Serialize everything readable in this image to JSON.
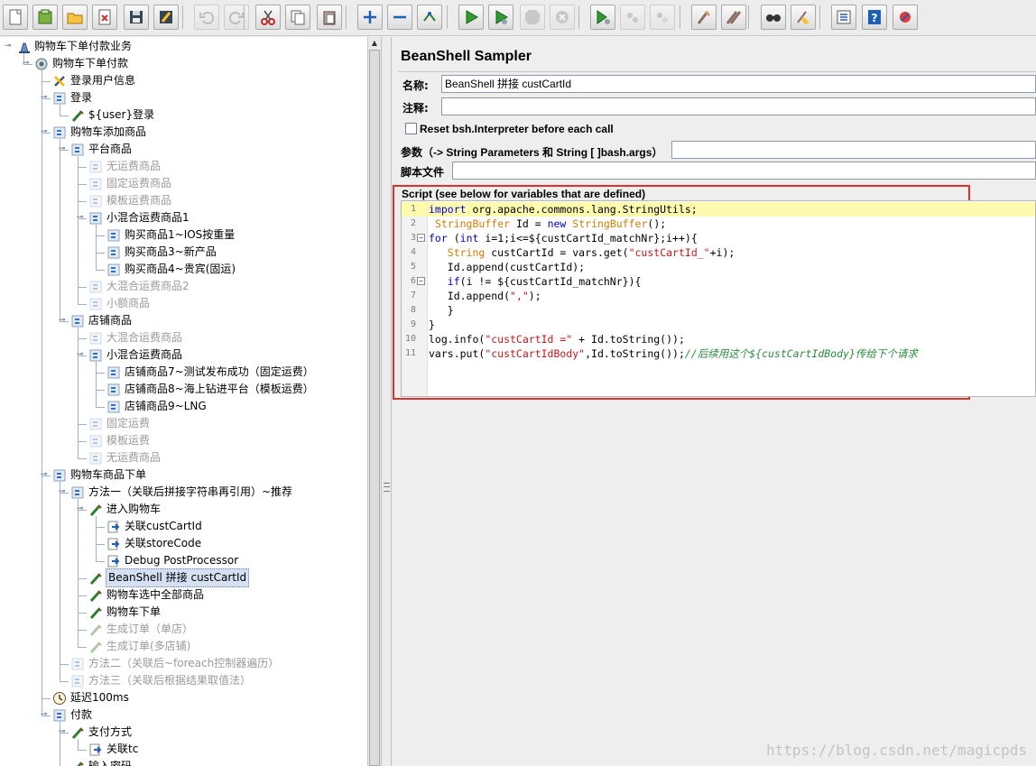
{
  "toolbar": {
    "buttons": [
      {
        "name": "new-icon",
        "disabled": false
      },
      {
        "name": "templates-icon",
        "disabled": false
      },
      {
        "name": "open-icon",
        "disabled": false
      },
      {
        "name": "close-icon",
        "disabled": false
      },
      {
        "name": "save-icon",
        "disabled": false
      },
      {
        "name": "save-screenshot-icon",
        "disabled": false
      },
      {
        "name": "undo-icon",
        "disabled": true
      },
      {
        "name": "redo-icon",
        "disabled": true
      },
      {
        "name": "cut-icon",
        "disabled": false
      },
      {
        "name": "copy-icon",
        "disabled": false
      },
      {
        "name": "paste-icon",
        "disabled": false
      },
      {
        "name": "expand-icon",
        "disabled": false
      },
      {
        "name": "collapse-icon",
        "disabled": false
      },
      {
        "name": "toggle-icon",
        "disabled": false
      },
      {
        "name": "start-icon",
        "disabled": false
      },
      {
        "name": "start-no-pauses-icon",
        "disabled": false
      },
      {
        "name": "stop-icon",
        "disabled": true
      },
      {
        "name": "shutdown-icon",
        "disabled": true
      },
      {
        "name": "remote-start-icon",
        "disabled": false
      },
      {
        "name": "remote-stop-icon",
        "disabled": true
      },
      {
        "name": "remote-shutdown-icon",
        "disabled": true
      },
      {
        "name": "clear-icon",
        "disabled": false
      },
      {
        "name": "clear-all-icon",
        "disabled": false
      },
      {
        "name": "search-icon",
        "disabled": false
      },
      {
        "name": "reset-search-icon",
        "disabled": false
      },
      {
        "name": "function-helper-icon",
        "disabled": false
      },
      {
        "name": "help-icon",
        "disabled": false
      },
      {
        "name": "options-icon",
        "disabled": false
      }
    ]
  },
  "tree": {
    "items": [
      {
        "label": "购物车下单付款业务",
        "icon": "test-plan-icon",
        "disabled": false,
        "selected": false
      },
      {
        "label": "购物车下单付款",
        "icon": "thread-group-icon",
        "disabled": false,
        "selected": false
      },
      {
        "label": "登录用户信息",
        "icon": "config-tools-icon",
        "disabled": false,
        "selected": false
      },
      {
        "label": "登录",
        "icon": "controller-icon",
        "disabled": false,
        "selected": false
      },
      {
        "label": "${user}登录",
        "icon": "sampler-icon",
        "disabled": false,
        "selected": false
      },
      {
        "label": "购物车添加商品",
        "icon": "controller-icon",
        "disabled": false,
        "selected": false
      },
      {
        "label": "平台商品",
        "icon": "controller-icon",
        "disabled": false,
        "selected": false
      },
      {
        "label": "无运费商品",
        "icon": "controller-icon",
        "disabled": true,
        "selected": false
      },
      {
        "label": "固定运费商品",
        "icon": "controller-icon",
        "disabled": true,
        "selected": false
      },
      {
        "label": "模板运费商品",
        "icon": "controller-icon",
        "disabled": true,
        "selected": false
      },
      {
        "label": "小混合运费商品1",
        "icon": "controller-icon",
        "disabled": false,
        "selected": false
      },
      {
        "label": "购买商品1~IOS按重量",
        "icon": "controller-icon",
        "disabled": false,
        "selected": false
      },
      {
        "label": "购买商品3~新产品",
        "icon": "controller-icon",
        "disabled": false,
        "selected": false
      },
      {
        "label": "购买商品4~贵宾(固运)",
        "icon": "controller-icon",
        "disabled": false,
        "selected": false
      },
      {
        "label": "大混合运费商品2",
        "icon": "controller-icon",
        "disabled": true,
        "selected": false
      },
      {
        "label": "小额商品",
        "icon": "controller-icon",
        "disabled": true,
        "selected": false
      },
      {
        "label": "店铺商品",
        "icon": "controller-icon",
        "disabled": false,
        "selected": false
      },
      {
        "label": "大混合运费商品",
        "icon": "controller-icon",
        "disabled": true,
        "selected": false
      },
      {
        "label": "小混合运费商品",
        "icon": "controller-icon",
        "disabled": false,
        "selected": false
      },
      {
        "label": "店铺商品7~测试发布成功（固定运费）",
        "icon": "controller-icon",
        "disabled": false,
        "selected": false
      },
      {
        "label": "店铺商品8~海上钻进平台（模板运费）",
        "icon": "controller-icon",
        "disabled": false,
        "selected": false
      },
      {
        "label": "店铺商品9~LNG",
        "icon": "controller-icon",
        "disabled": false,
        "selected": false
      },
      {
        "label": "固定运费",
        "icon": "controller-icon",
        "disabled": true,
        "selected": false
      },
      {
        "label": "模板运费",
        "icon": "controller-icon",
        "disabled": true,
        "selected": false
      },
      {
        "label": "无运费商品",
        "icon": "controller-icon",
        "disabled": true,
        "selected": false
      },
      {
        "label": "购物车商品下单",
        "icon": "controller-icon",
        "disabled": false,
        "selected": false
      },
      {
        "label": "方法一（关联后拼接字符串再引用）~推荐",
        "icon": "controller-icon",
        "disabled": false,
        "selected": false
      },
      {
        "label": "进入购物车",
        "icon": "sampler-icon",
        "disabled": false,
        "selected": false
      },
      {
        "label": "关联custCartId",
        "icon": "post-processor-icon",
        "disabled": false,
        "selected": false
      },
      {
        "label": "关联storeCode",
        "icon": "post-processor-icon",
        "disabled": false,
        "selected": false
      },
      {
        "label": "Debug PostProcessor",
        "icon": "post-processor-icon",
        "disabled": false,
        "selected": false
      },
      {
        "label": "BeanShell 拼接 custCartId",
        "icon": "sampler-icon",
        "disabled": false,
        "selected": true
      },
      {
        "label": "购物车选中全部商品",
        "icon": "sampler-icon",
        "disabled": false,
        "selected": false
      },
      {
        "label": "购物车下单",
        "icon": "sampler-icon",
        "disabled": false,
        "selected": false
      },
      {
        "label": "生成订单（单店）",
        "icon": "sampler-icon",
        "disabled": true,
        "selected": false
      },
      {
        "label": "生成订单(多店铺)",
        "icon": "sampler-icon",
        "disabled": true,
        "selected": false
      },
      {
        "label": "方法二（关联后~foreach控制器遍历）",
        "icon": "controller-icon",
        "disabled": true,
        "selected": false
      },
      {
        "label": "方法三（关联后根据结果取值法）",
        "icon": "controller-icon",
        "disabled": true,
        "selected": false
      },
      {
        "label": "延迟100ms",
        "icon": "timer-icon",
        "disabled": false,
        "selected": false
      },
      {
        "label": "付款",
        "icon": "controller-icon",
        "disabled": false,
        "selected": false
      },
      {
        "label": "支付方式",
        "icon": "sampler-icon",
        "disabled": false,
        "selected": false
      },
      {
        "label": "关联tc",
        "icon": "post-processor-icon",
        "disabled": false,
        "selected": false
      },
      {
        "label": "输入密码",
        "icon": "sampler-icon",
        "disabled": false,
        "selected": false
      }
    ]
  },
  "sampler": {
    "title": "BeanShell Sampler",
    "name_label": "名称:",
    "name_value": "BeanShell 拼接 custCartId",
    "comment_label": "注释:",
    "comment_value": "",
    "reset_label": "Reset bsh.Interpreter before each call",
    "reset_checked": false,
    "params_label": "参数（-> String Parameters 和 String [ ]bash.args）",
    "params_value": "",
    "script_file_label": "脚本文件",
    "script_file_value": "",
    "script_legend": "Script (see below for variables that are defined)"
  },
  "script": {
    "current_line": 1,
    "lines": [
      {
        "n": "1",
        "fold": "",
        "tokens": [
          {
            "c": "kw",
            "t": "import"
          },
          {
            "c": "tx",
            "t": " org.apache.commons.lang.StringUtils;"
          }
        ]
      },
      {
        "n": "2",
        "fold": "",
        "tokens": [
          {
            "c": "tx",
            "t": " "
          },
          {
            "c": "ty",
            "t": "StringBuffer"
          },
          {
            "c": "tx",
            "t": " Id = "
          },
          {
            "c": "kw",
            "t": "new"
          },
          {
            "c": "tx",
            "t": " "
          },
          {
            "c": "ty",
            "t": "StringBuffer"
          },
          {
            "c": "tx",
            "t": "();"
          }
        ]
      },
      {
        "n": "3",
        "fold": "−",
        "tokens": [
          {
            "c": "kw",
            "t": "for"
          },
          {
            "c": "tx",
            "t": " ("
          },
          {
            "c": "kw",
            "t": "int"
          },
          {
            "c": "tx",
            "t": " i=1;i<=${custCartId_matchNr};i++){"
          }
        ]
      },
      {
        "n": "4",
        "fold": "",
        "tokens": [
          {
            "c": "tx",
            "t": "   "
          },
          {
            "c": "ty",
            "t": "String"
          },
          {
            "c": "tx",
            "t": " custCartId = vars.get("
          },
          {
            "c": "st",
            "t": "\"custCartId_\""
          },
          {
            "c": "tx",
            "t": "+i);"
          }
        ]
      },
      {
        "n": "5",
        "fold": "",
        "tokens": [
          {
            "c": "tx",
            "t": "   Id.append(custCartId);"
          }
        ]
      },
      {
        "n": "6",
        "fold": "−",
        "tokens": [
          {
            "c": "tx",
            "t": "   "
          },
          {
            "c": "kw",
            "t": "if"
          },
          {
            "c": "tx",
            "t": "(i != ${custCartId_matchNr}){"
          }
        ]
      },
      {
        "n": "7",
        "fold": "",
        "tokens": [
          {
            "c": "tx",
            "t": "   Id.append("
          },
          {
            "c": "st",
            "t": "\",\""
          },
          {
            "c": "tx",
            "t": ");"
          }
        ]
      },
      {
        "n": "8",
        "fold": "",
        "tokens": [
          {
            "c": "tx",
            "t": "   }"
          }
        ]
      },
      {
        "n": "9",
        "fold": "",
        "tokens": [
          {
            "c": "tx",
            "t": "}"
          }
        ]
      },
      {
        "n": "10",
        "fold": "",
        "tokens": [
          {
            "c": "tx",
            "t": "log.info("
          },
          {
            "c": "st",
            "t": "\"custCartId =\""
          },
          {
            "c": "tx",
            "t": " + Id.toString());"
          }
        ]
      },
      {
        "n": "11",
        "fold": "",
        "tokens": [
          {
            "c": "tx",
            "t": "vars.put("
          },
          {
            "c": "st",
            "t": "\"custCartIdBody\""
          },
          {
            "c": "tx",
            "t": ",Id.toString());"
          },
          {
            "c": "cm",
            "t": "//后续用这个${custCartIdBody}传给下个请求"
          }
        ]
      }
    ]
  },
  "watermark": "https://blog.csdn.net/magicpds",
  "colors": {
    "highlight_box": "#e0302e",
    "selection_bg": "#d5e1f2",
    "current_line_bg": "#fffbae",
    "keyword": "#0000d6",
    "type": "#d67c00",
    "string": "#c6171a",
    "comment": "#2b8a3e"
  }
}
